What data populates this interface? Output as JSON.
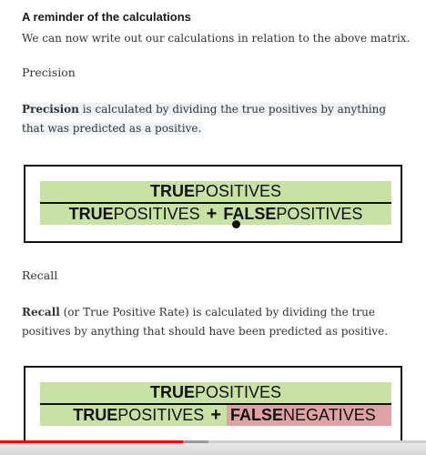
{
  "heading": "A reminder of the calculations",
  "intro": "We can now write out our calculations in relation to the above matrix.",
  "precision": {
    "subheading": "Precision",
    "lead": "Precision",
    "body": " is calculated by dividing the true positives by anything that was predicted as a positive.",
    "formula": {
      "num_bold": "TRUE",
      "num_rest": " POSITIVES",
      "den_a_bold": "TRUE",
      "den_a_rest": " POSITIVES",
      "plus": "+",
      "den_b_bold": "FALSE",
      "den_b_rest": " POSITIVES"
    }
  },
  "recall": {
    "subheading": "Recall",
    "lead": "Recall",
    "body": " (or True Positive Rate) is calculated by dividing the true positives by anything that should have been predicted as positive.",
    "formula": {
      "num_bold": "TRUE",
      "num_rest": " POSITIVES",
      "den_a_bold": "TRUE",
      "den_a_rest": " POSITIVES",
      "plus": "+",
      "den_b_bold": "FALSE",
      "den_b_rest": " NEGATIVES"
    }
  },
  "video": {
    "played_fraction": 0.43,
    "buffered_fraction": 0.49
  },
  "colors": {
    "positive_fill": "#c7e2a4",
    "negative_fill": "#dfa3a3",
    "progress": "#ff0000"
  }
}
